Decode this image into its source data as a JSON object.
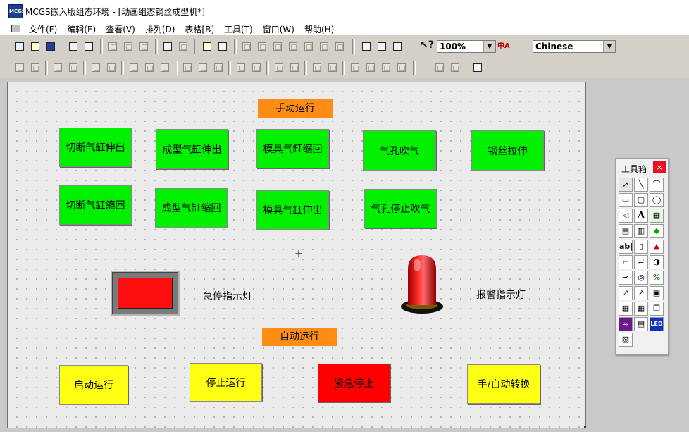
{
  "window": {
    "title": "MCGS嵌入版组态环境 - [动画组态钢丝成型机*]",
    "icon": "mcgs-app-icon"
  },
  "menu": [
    "文件(F)",
    "编辑(E)",
    "查看(V)",
    "排列(D)",
    "表格[B]",
    "工具(T)",
    "窗口(W)",
    "帮助(H)"
  ],
  "toolbar": {
    "zoom": "100%",
    "language": "Chinese"
  },
  "canvas": {
    "manual_header": "手动运行",
    "auto_header": "自动运行",
    "manual_buttons": [
      "切断气缸伸出",
      "成型气缸伸出",
      "模具气缸缩回",
      "气孔吹气",
      "钢丝拉伸",
      "切断气缸缩回",
      "成型气缸缩回",
      "模具气缸伸出",
      "气孔停止吹气"
    ],
    "estop_label": "急停指示灯",
    "alarm_label": "报警指示灯",
    "auto_buttons": [
      "启动运行",
      "停止运行",
      "紧急停止",
      "手/自动转换"
    ],
    "colors": {
      "green": "#00f000",
      "yellow": "#ffff14",
      "red": "#ff0000",
      "orange": "#ff8c14"
    }
  },
  "toolbox": {
    "title": "工具箱",
    "close": "×",
    "tools": [
      "pointer-icon",
      "line-icon",
      "arc-icon",
      "rectangle-icon",
      "rounded-rect-icon",
      "ellipse-icon",
      "polygon-icon",
      "label-text-icon",
      "bitmap-icon",
      "pipe-icon",
      "pipe-flow-icon",
      "symbol-library-icon",
      "input-box-icon",
      "slider-icon",
      "alarm-icon",
      "polyline-icon",
      "curve-icon",
      "gauge-icon",
      "rotary-icon",
      "dial-icon",
      "percent-icon",
      "trend-icon",
      "history-icon",
      "button-icon",
      "table-icon",
      "grid-table-icon",
      "sub-window-icon",
      "chart-icon",
      "list-icon",
      "led-icon",
      "media-icon"
    ],
    "text_tools": {
      "label": "A",
      "input": "ab|",
      "led": "LED"
    }
  }
}
